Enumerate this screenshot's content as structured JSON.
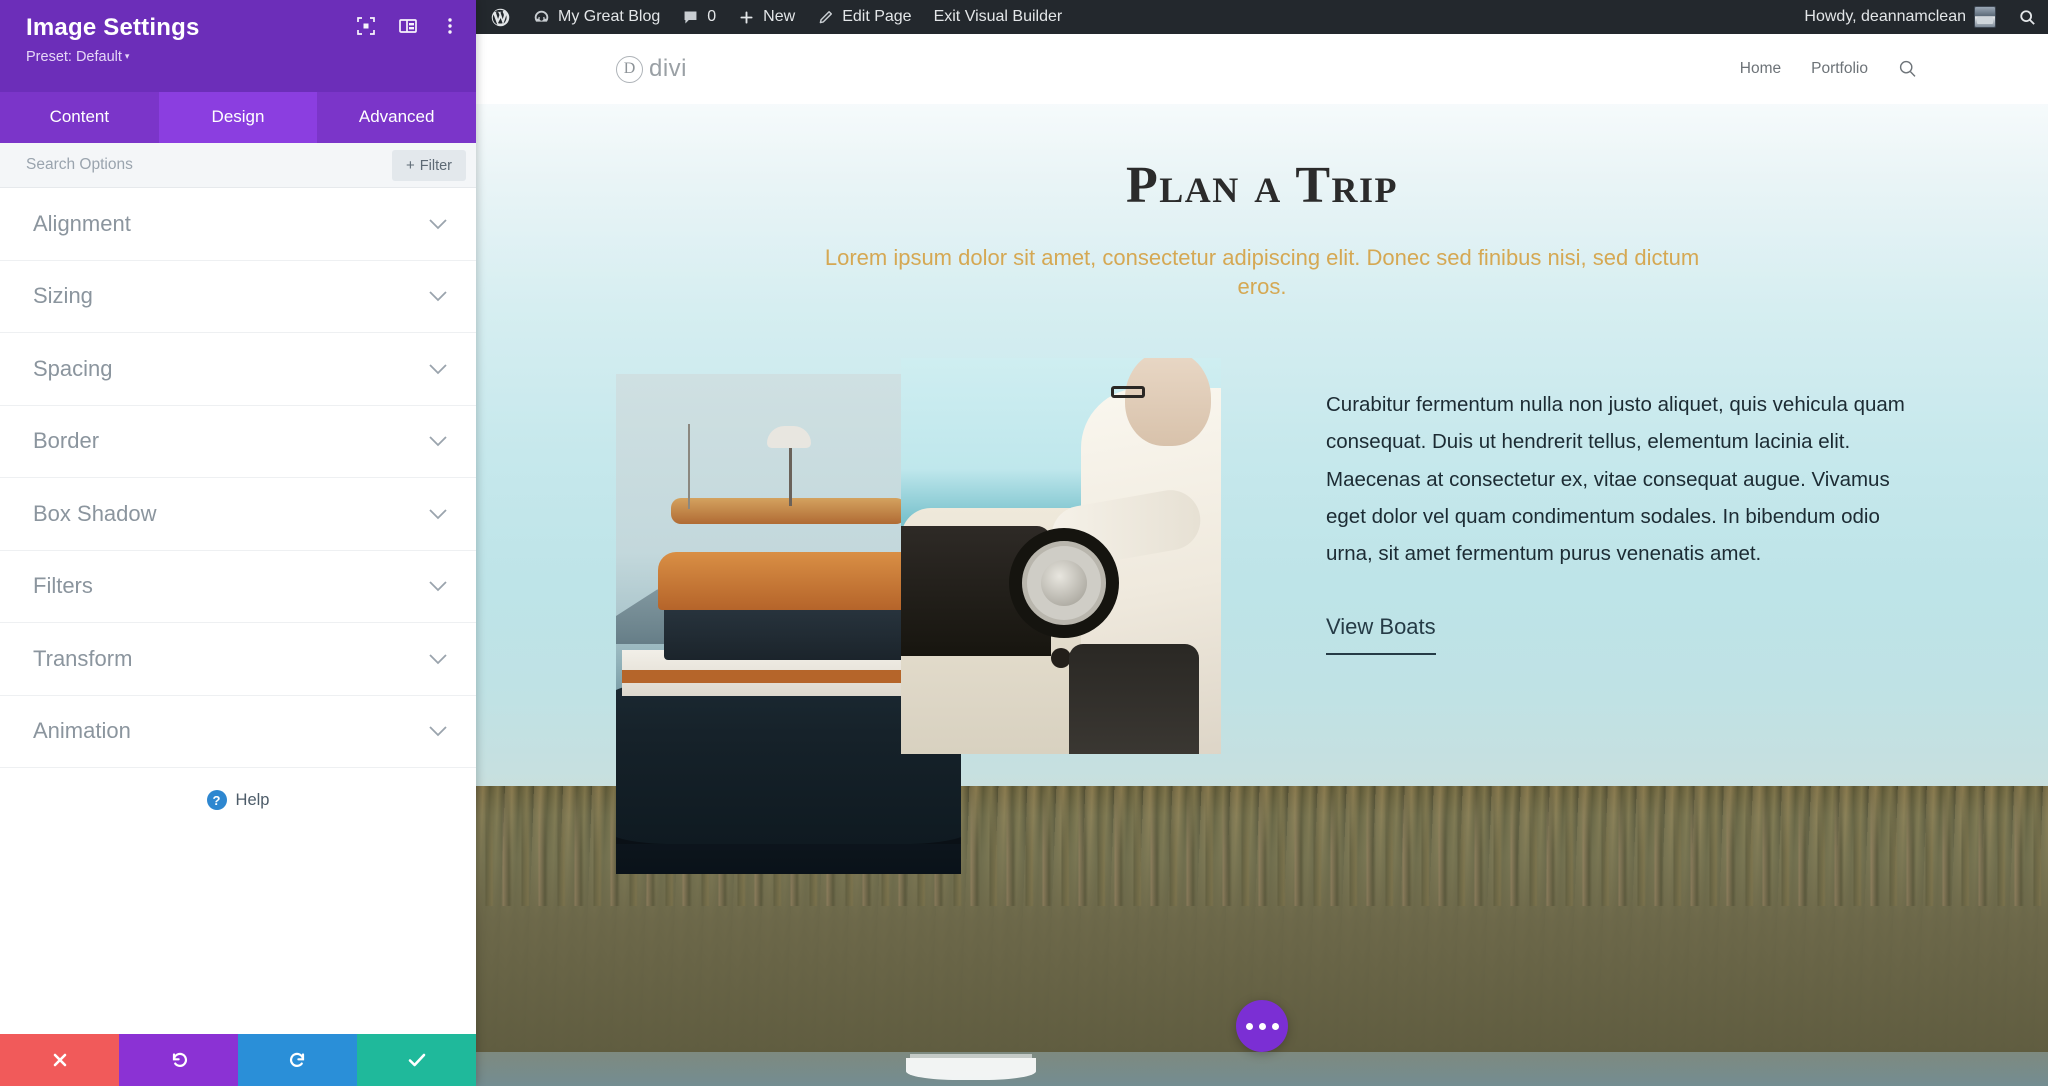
{
  "panel": {
    "title": "Image Settings",
    "preset_label": "Preset: Default",
    "header_icons": [
      {
        "name": "focus-target-icon",
        "glyph": "focus"
      },
      {
        "name": "layout-columns-icon",
        "glyph": "layout"
      },
      {
        "name": "more-vertical-icon",
        "glyph": "kebab"
      }
    ],
    "tabs": [
      {
        "label": "Content",
        "active": false
      },
      {
        "label": "Design",
        "active": true
      },
      {
        "label": "Advanced",
        "active": false
      }
    ],
    "search": {
      "placeholder": "Search Options",
      "value": ""
    },
    "filter_button": {
      "plus": "+",
      "label": "Filter"
    },
    "sections": [
      {
        "label": "Alignment"
      },
      {
        "label": "Sizing"
      },
      {
        "label": "Spacing"
      },
      {
        "label": "Border"
      },
      {
        "label": "Box Shadow"
      },
      {
        "label": "Filters"
      },
      {
        "label": "Transform"
      },
      {
        "label": "Animation"
      }
    ],
    "help": {
      "icon_text": "?",
      "label": "Help"
    },
    "footer_buttons": [
      {
        "name": "cancel-button",
        "color": "#f15a5a"
      },
      {
        "name": "undo-button",
        "color": "#8b32d4"
      },
      {
        "name": "redo-button",
        "color": "#2a8fd8"
      },
      {
        "name": "save-button",
        "color": "#1fb99b"
      }
    ],
    "colors": {
      "header_purple": "#6c2eb9",
      "tabs_purple": "#7b35c9",
      "active_tab": "#8b3ee0"
    }
  },
  "adminbar": {
    "wp_logo": "wordpress-icon",
    "site_name": "My Great Blog",
    "comment_count": "0",
    "new_label": "New",
    "edit_page_label": "Edit Page",
    "exit_builder_label": "Exit Visual Builder",
    "howdy": "Howdy, deannamclean",
    "background": "#23282d"
  },
  "site": {
    "logo": {
      "mark": "D",
      "text": "divi"
    },
    "nav": [
      {
        "label": "Home"
      },
      {
        "label": "Portfolio"
      }
    ],
    "nav_search_icon": "search-icon",
    "title": "Plan a Trip",
    "subtitle": "Lorem ipsum dolor sit amet, consectetur adipiscing elit. Donec sed finibus nisi, sed dictum eros.",
    "subtitle_color": "#d5a853",
    "body": "Curabitur fermentum nulla non justo aliquet, quis vehicula quam consequat. Duis ut hendrerit tellus, elementum lacinia elit. Maecenas at consectetur ex, vitae consequat augue. Vivamus eget dolor vel quam condimentum sodales. In bibendum odio urna, sit amet fermentum purus venenatis amet.",
    "cta_label": "View Boats",
    "gallery": [
      {
        "name": "photo-trawler-at-dock",
        "alt": "Vintage trawler yacht moored at a dock"
      },
      {
        "name": "photo-person-steering-boat",
        "alt": "Person steering a motorboat at the helm"
      }
    ]
  },
  "fab": {
    "name": "builder-menu-fab",
    "dots": 3,
    "color": "#7b2fd4"
  }
}
